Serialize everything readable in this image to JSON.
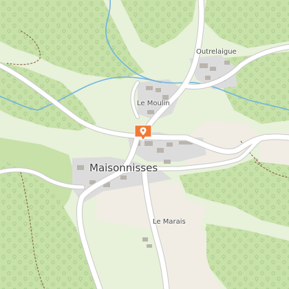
{
  "map": {
    "type": "topographic",
    "colors": {
      "meadow": "#e8f1da",
      "forest": "#c7e1a9",
      "tree_symbol": "#a9cf8e",
      "farmland": "#f1ede4",
      "built_up": "#dcdcdc",
      "building": "#b9b4ad",
      "road": "#ffffff",
      "road_casing": "#c8c8c8",
      "stream": "#6fb4e0",
      "trail": "#8b6a4a",
      "marker": "#f07a35"
    },
    "labels": {
      "village": "Maisonnisses",
      "hamlet_ne": "Outrelaigue",
      "hamlet_mill": "Le Moulin",
      "hamlet_south": "Le Marais"
    },
    "marker": {
      "icon": "location-pin-icon",
      "color": "#f07a35"
    }
  }
}
